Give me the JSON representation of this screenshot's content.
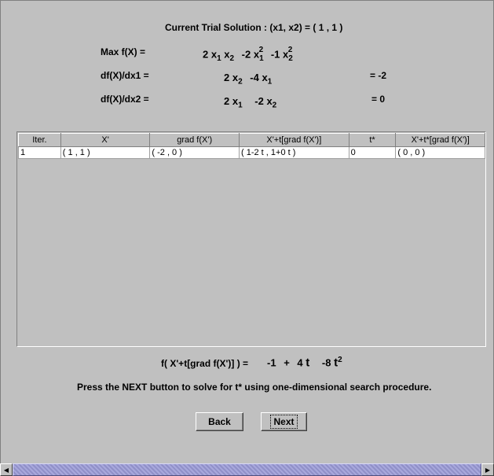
{
  "header": {
    "title": "Current Trial Solution : (x1, x2) = ( 1 , 1 )"
  },
  "equations": {
    "f_label": "Max  f(X) =",
    "f_terms": {
      "c1": "2",
      "c2": "-2",
      "c3": "-1"
    },
    "d1_label": "df(X)/dx1 =",
    "d1_terms": {
      "c1": "2",
      "c2": "-4"
    },
    "d1_value": "= -2",
    "d2_label": "df(X)/dx2 =",
    "d2_terms": {
      "c1": "2",
      "c2": "-2"
    },
    "d2_value": "= 0"
  },
  "table": {
    "headers": [
      "Iter.",
      "X'",
      "grad f(X')",
      "X'+t[grad f(X')]",
      "t*",
      "X'+t*[grad f(X')]"
    ],
    "rows": [
      [
        "1",
        "( 1 , 1 )",
        "( -2 , 0 )",
        "( 1-2 t , 1+0 t )",
        "0",
        "( 0 , 0 )"
      ]
    ]
  },
  "line_search": {
    "label": "f( X'+t[grad f(X')] )  =",
    "c0": "-1",
    "plus": "+",
    "c1": "4",
    "c2": "-8",
    "var": "t"
  },
  "instruction": "Press the NEXT button to solve for t* using one-dimensional search procedure.",
  "buttons": {
    "back": "Back",
    "next": "Next"
  },
  "scrollbar": {
    "left_arrow": "◀",
    "right_arrow": "▶"
  }
}
